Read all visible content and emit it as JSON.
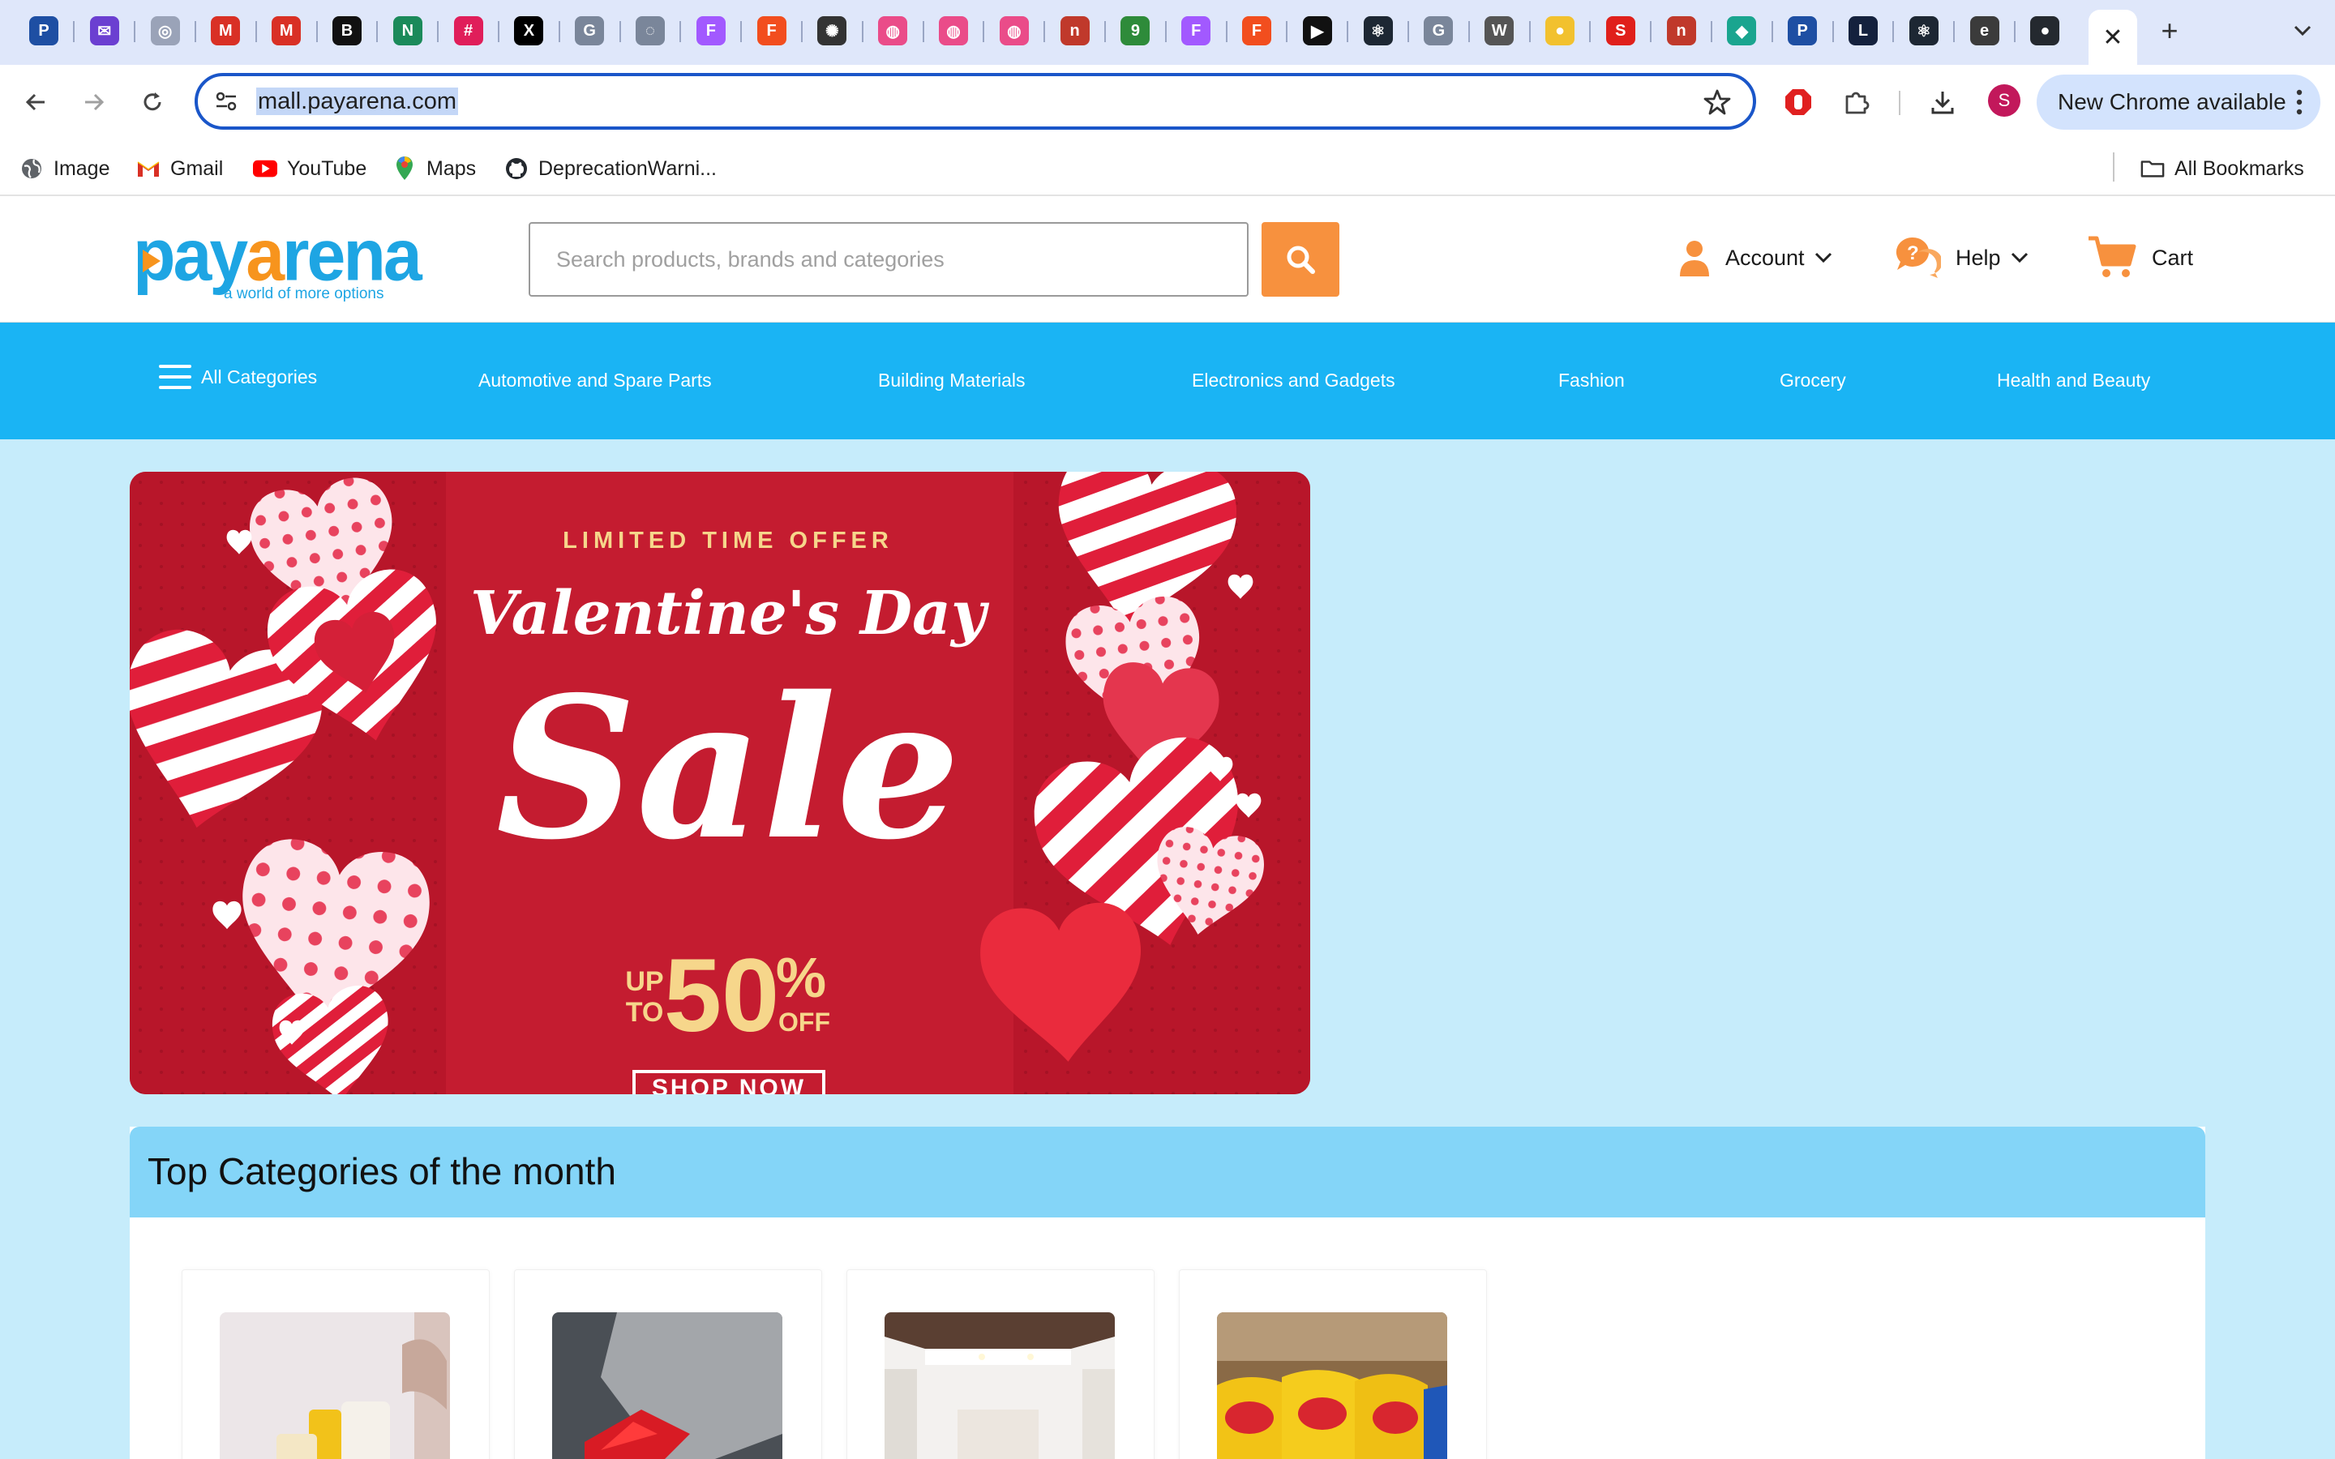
{
  "browser": {
    "tabs": [
      {
        "icon": "payarena-icon",
        "color": "#1e4fa3",
        "glyph": "P"
      },
      {
        "icon": "mail-icon",
        "color": "#6b3fd1",
        "glyph": "✉"
      },
      {
        "icon": "chrome-icon",
        "color": "#9aa3b8",
        "glyph": "◎"
      },
      {
        "icon": "gmail-icon",
        "color": "#d93025",
        "glyph": "M"
      },
      {
        "icon": "gmail-icon",
        "color": "#d93025",
        "glyph": "M"
      },
      {
        "icon": "b-icon",
        "color": "#111111",
        "glyph": "B"
      },
      {
        "icon": "n-icon",
        "color": "#1b8a5a",
        "glyph": "N"
      },
      {
        "icon": "slack-icon",
        "color": "#e01e5a",
        "glyph": "#"
      },
      {
        "icon": "x-icon",
        "color": "#000000",
        "glyph": "X"
      },
      {
        "icon": "google-icon",
        "color": "#7a869a",
        "glyph": "G"
      },
      {
        "icon": "site-icon",
        "color": "#7a869a",
        "glyph": "◌"
      },
      {
        "icon": "figma-icon",
        "color": "#a259ff",
        "glyph": "F"
      },
      {
        "icon": "figma-icon",
        "color": "#f24e1e",
        "glyph": "F"
      },
      {
        "icon": "openai-icon",
        "color": "#333333",
        "glyph": "✺"
      },
      {
        "icon": "dribbble-icon",
        "color": "#ea4c89",
        "glyph": "◍"
      },
      {
        "icon": "dribbble-icon",
        "color": "#ea4c89",
        "glyph": "◍"
      },
      {
        "icon": "dribbble-icon",
        "color": "#ea4c89",
        "glyph": "◍"
      },
      {
        "icon": "n-icon",
        "color": "#c0392b",
        "glyph": "n"
      },
      {
        "icon": "9ja-icon",
        "color": "#2e8b3a",
        "glyph": "9"
      },
      {
        "icon": "figma-icon",
        "color": "#a259ff",
        "glyph": "F"
      },
      {
        "icon": "figma-icon",
        "color": "#f24e1e",
        "glyph": "F"
      },
      {
        "icon": "play-icon",
        "color": "#111111",
        "glyph": "▶"
      },
      {
        "icon": "react-icon",
        "color": "#1d2733",
        "glyph": "⚛"
      },
      {
        "icon": "google-icon",
        "color": "#7a869a",
        "glyph": "G"
      },
      {
        "icon": "wikipedia-icon",
        "color": "#555555",
        "glyph": "W"
      },
      {
        "icon": "bank-icon",
        "color": "#f2c12e",
        "glyph": "●"
      },
      {
        "icon": "s-icon",
        "color": "#e0201b",
        "glyph": "S"
      },
      {
        "icon": "n-icon",
        "color": "#c0392b",
        "glyph": "n"
      },
      {
        "icon": "diamond-icon",
        "color": "#1aa58f",
        "glyph": "◆"
      },
      {
        "icon": "payarena-icon",
        "color": "#1e4fa3",
        "glyph": "P"
      },
      {
        "icon": "live-icon",
        "color": "#14213d",
        "glyph": "L"
      },
      {
        "icon": "react-icon",
        "color": "#1d2733",
        "glyph": "⚛"
      },
      {
        "icon": "e-icon",
        "color": "#3b3b3b",
        "glyph": "e"
      },
      {
        "icon": "github-icon",
        "color": "#24292f",
        "glyph": "●"
      }
    ],
    "active_tab_close": "✕",
    "new_tab": "+",
    "url": "mall.payarena.com",
    "update_label": "New Chrome available",
    "profile_initial": "S",
    "bookmarks": [
      {
        "label": "Image",
        "icon": "globe-icon"
      },
      {
        "label": "Gmail",
        "icon": "gmail-icon"
      },
      {
        "label": "YouTube",
        "icon": "youtube-icon"
      },
      {
        "label": "Maps",
        "icon": "maps-icon"
      },
      {
        "label": "DeprecationWarni...",
        "icon": "github-icon"
      }
    ],
    "all_bookmarks": "All Bookmarks"
  },
  "site": {
    "logo": {
      "text_blue": "pay",
      "text_orange": "a",
      "text_blue2": "rena",
      "tagline": "a world of more options"
    },
    "search_placeholder": "Search products, brands and categories",
    "account_label": "Account",
    "help_label": "Help",
    "cart_label": "Cart",
    "colors": {
      "accent_orange": "#f7913e",
      "nav_blue": "#1ab4f4",
      "page_bg": "#c6ecfb",
      "section_head": "#84d5f8"
    }
  },
  "categories_nav": {
    "all": "All Categories",
    "items": [
      "Automotive and Spare Parts",
      "Building Materials",
      "Electronics and Gadgets",
      "Fashion",
      "Grocery",
      "Health and Beauty"
    ]
  },
  "banner": {
    "kicker": "LIMITED TIME OFFER",
    "headline": "Valentine's Day",
    "big": "Sale",
    "up": "UP",
    "to": "TO",
    "percent_value": "50",
    "percent_sign": "%",
    "off": "OFF",
    "cta": "SHOP NOW"
  },
  "top_categories": {
    "title": "Top Categories of the month",
    "cards": [
      {
        "image": "beauty-products-photo"
      },
      {
        "image": "gift-box-photo"
      },
      {
        "image": "interior-room-photo"
      },
      {
        "image": "snacks-chips-photo"
      }
    ]
  }
}
